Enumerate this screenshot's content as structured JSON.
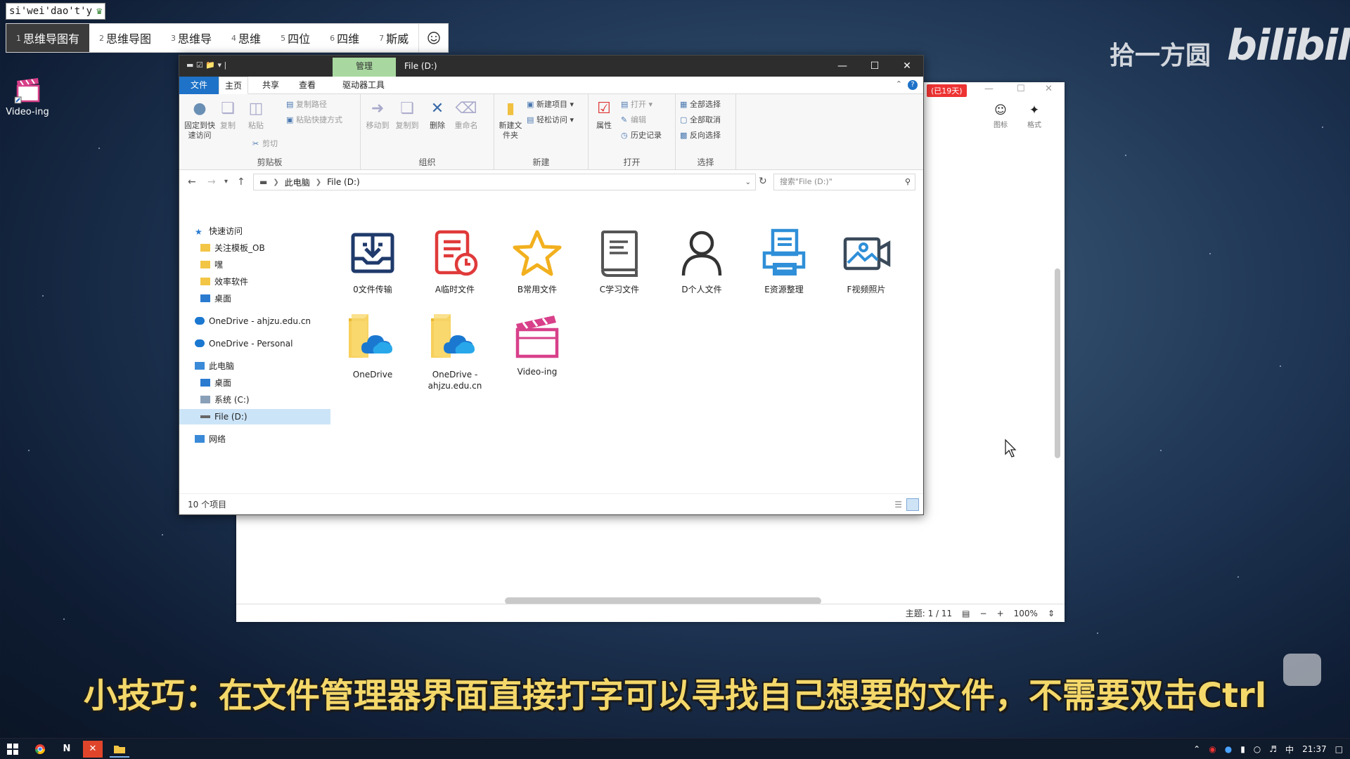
{
  "ime": {
    "composition": "si'wei'dao't'y",
    "candidates": [
      {
        "num": "1",
        "text": "思维导图有"
      },
      {
        "num": "2",
        "text": "思维导图"
      },
      {
        "num": "3",
        "text": "思维导"
      },
      {
        "num": "4",
        "text": "思维"
      },
      {
        "num": "5",
        "text": "四位"
      },
      {
        "num": "6",
        "text": "四维"
      },
      {
        "num": "7",
        "text": "斯威"
      }
    ]
  },
  "desktop": {
    "shortcut_label": "Video-ing"
  },
  "watermark": {
    "text": "拾一方圆",
    "logo": "bilibili"
  },
  "background_window": {
    "badge": "(已19天)",
    "tools": [
      {
        "label": "图标",
        "icon": "smiley-icon"
      },
      {
        "label": "格式",
        "icon": "brush-icon"
      }
    ],
    "status": {
      "topic": "主题: 1 / 11",
      "zoom": "100%"
    }
  },
  "explorer": {
    "context_tab": "管理",
    "title": "File (D:)",
    "tabs": [
      "文件",
      "主页",
      "共享",
      "查看",
      "驱动器工具"
    ],
    "ribbon": {
      "clipboard": {
        "name": "剪贴板",
        "pin": "固定到快速访问",
        "copy": "复制",
        "paste": "粘贴",
        "copy_path": "复制路径",
        "paste_shortcut": "粘贴快捷方式",
        "cut": "剪切"
      },
      "organize": {
        "name": "组织",
        "move_to": "移动到",
        "copy_to": "复制到",
        "delete": "删除",
        "rename": "重命名"
      },
      "new": {
        "name": "新建",
        "new_item": "新建项目",
        "easy_access": "轻松访问",
        "new_folder": "新建文件夹"
      },
      "open": {
        "name": "打开",
        "properties": "属性",
        "open": "打开",
        "edit": "编辑",
        "history": "历史记录"
      },
      "select": {
        "name": "选择",
        "select_all": "全部选择",
        "select_none": "全部取消",
        "invert": "反向选择"
      }
    },
    "address": {
      "this_pc": "此电脑",
      "drive": "File (D:)"
    },
    "search_placeholder": "搜索\"File (D:)\"",
    "nav": {
      "quick_access": "快速访问",
      "quick_items": [
        "关注模板_OB",
        "嘿",
        "效率软件",
        "桌面"
      ],
      "onedrive_edu": "OneDrive - ahjzu.edu.cn",
      "onedrive_personal": "OneDrive - Personal",
      "this_pc": "此电脑",
      "pc_items": [
        "桌面",
        "系统 (C:)",
        "File (D:)"
      ],
      "network": "网络"
    },
    "files": [
      {
        "name": "0文件传输",
        "icon": "download-folder-icon",
        "color": "#1f3a6b"
      },
      {
        "name": "A临时文件",
        "icon": "temp-document-icon",
        "color": "#e03a3a"
      },
      {
        "name": "B常用文件",
        "icon": "star-icon",
        "color": "#f2b01e"
      },
      {
        "name": "C学习文件",
        "icon": "book-icon",
        "color": "#555555"
      },
      {
        "name": "D个人文件",
        "icon": "person-icon",
        "color": "#333333"
      },
      {
        "name": "E资源整理",
        "icon": "printer-icon",
        "color": "#2f8fd8"
      },
      {
        "name": "F视频照片",
        "icon": "video-photo-icon",
        "color": "#3a4a5a"
      },
      {
        "name": "OneDrive",
        "icon": "onedrive-folder-icon",
        "color": "#f5c242"
      },
      {
        "name": "OneDrive - ahjzu.edu.cn",
        "icon": "onedrive-folder-icon",
        "color": "#f5c242"
      },
      {
        "name": "Video-ing",
        "icon": "clapperboard-icon",
        "color": "#d8408a"
      }
    ],
    "status": "10 个项目"
  },
  "subtitle": "小技巧：在文件管理器界面直接打字可以寻找自己想要的文件，不需要双击Ctrl",
  "taskbar": {
    "ime_mode": "中",
    "time": "21:37"
  }
}
